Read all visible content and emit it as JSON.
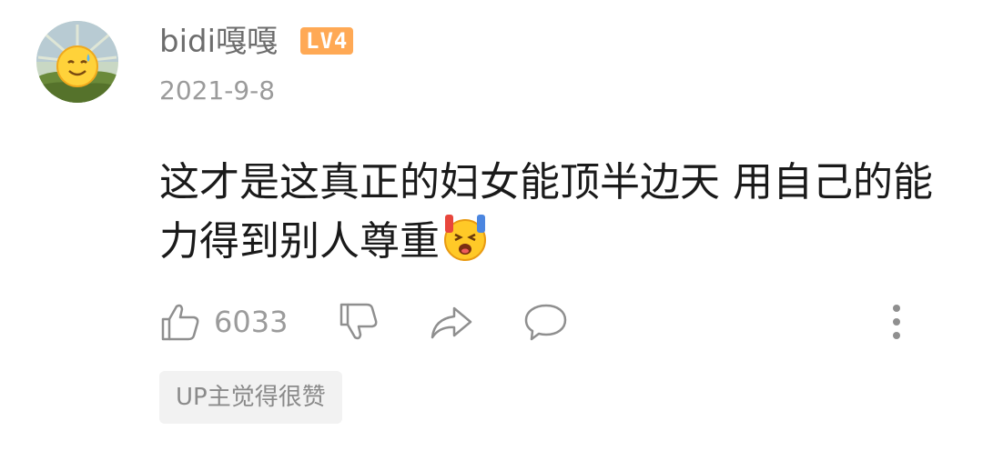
{
  "comment": {
    "user": {
      "name": "bidi嘎嘎",
      "level": "LV4",
      "avatar_icon": "sun-emoji-avatar"
    },
    "date": "2021-9-8",
    "text": "这才是这真正的妇女能顶半边天 用自己的能力得到别人尊重",
    "inline_emoji": "shocked-emoji",
    "actions": {
      "like_icon": "thumbs-up-icon",
      "like_count": "6033",
      "dislike_icon": "thumbs-down-icon",
      "share_icon": "share-icon",
      "reply_icon": "reply-icon",
      "more_icon": "more-icon"
    },
    "tag": "UP主觉得很赞"
  },
  "colors": {
    "level_badge": "#ffa955",
    "muted_text": "#9b9b9b",
    "tag_bg": "#f2f2f2"
  }
}
